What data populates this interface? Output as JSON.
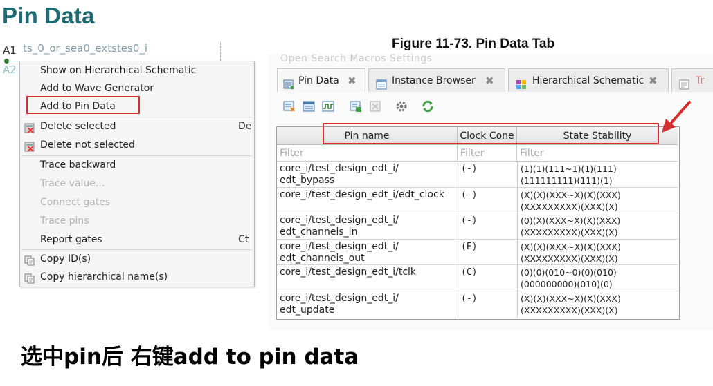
{
  "title": "Pin Data",
  "schematic": {
    "instance_label": "ts_0_or_sea0_extstes0_i",
    "a1": "A1",
    "a2": "A2"
  },
  "context_menu": {
    "items": [
      {
        "label": "Show on Hierarchical Schematic",
        "icon": "",
        "enabled": true,
        "shortcut": ""
      },
      {
        "label": "Add to Wave Generator",
        "icon": "",
        "enabled": true,
        "shortcut": ""
      },
      {
        "label": "Add to Pin Data",
        "icon": "",
        "enabled": true,
        "shortcut": "",
        "highlighted": true
      },
      {
        "label": "Delete selected",
        "icon": "delete-icon",
        "enabled": true,
        "shortcut": "De"
      },
      {
        "label": "Delete not selected",
        "icon": "delete-icon",
        "enabled": true,
        "shortcut": ""
      },
      {
        "label": "Trace backward",
        "icon": "",
        "enabled": true,
        "shortcut": ""
      },
      {
        "label": "Trace value...",
        "icon": "",
        "enabled": false,
        "shortcut": ""
      },
      {
        "label": "Connect gates",
        "icon": "",
        "enabled": false,
        "shortcut": ""
      },
      {
        "label": "Trace pins",
        "icon": "",
        "enabled": false,
        "shortcut": ""
      },
      {
        "label": "Report gates",
        "icon": "",
        "enabled": true,
        "shortcut": "Ct"
      },
      {
        "label": "Copy ID(s)",
        "icon": "copy-icon",
        "enabled": true,
        "shortcut": ""
      },
      {
        "label": "Copy hierarchical name(s)",
        "icon": "copy-icon",
        "enabled": true,
        "shortcut": ""
      }
    ]
  },
  "figure_caption": "Figure 11-73. Pin Data Tab",
  "ghost_menubar": "Open   Search   Macros   Settings",
  "tabs": [
    {
      "label": "Pin Data",
      "icon": "pin-data-icon",
      "active": true
    },
    {
      "label": "Instance Browser",
      "icon": "instance-browser-icon",
      "active": false
    },
    {
      "label": "Hierarchical Schematic",
      "icon": "schematic-icon",
      "active": false
    },
    {
      "label": "Tr",
      "icon": "trace-icon",
      "active": false
    }
  ],
  "toolbar_icons": [
    "add-pin-icon",
    "list-icon",
    "wave-icon",
    "export-icon",
    "clear-icon",
    "settings-icon",
    "refresh-icon"
  ],
  "table": {
    "columns": [
      "Pin name",
      "Clock Cone",
      "State Stability"
    ],
    "filter_placeholder": "Filter",
    "rows": [
      {
        "pin": "core_i/test_design_edt_i/\nedt_bypass",
        "cone": "(-)",
        "stability": "(1)(1)(111~1)(1)(111)\n(111111111)(111)(1)"
      },
      {
        "pin": "core_i/test_design_edt_i/edt_clock",
        "cone": "(-)",
        "stability": "(X)(X)(XXX~X)(X)(XXX)\n(XXXXXXXXX)(XXX)(X)"
      },
      {
        "pin": "core_i/test_design_edt_i/\nedt_channels_in",
        "cone": "(-)",
        "stability": "(0)(X)(XXX~X)(X)(XXX)\n(XXXXXXXXX)(XXX)(X)"
      },
      {
        "pin": "core_i/test_design_edt_i/\nedt_channels_out",
        "cone": "(E)",
        "stability": "(X)(X)(XXX~X)(X)(XXX)\n(XXXXXXXXX)(XXX)(X)"
      },
      {
        "pin": "core_i/test_design_edt_i/tclk",
        "cone": "(C)",
        "stability": "(0)(0)(010~0)(0)(010)\n(000000000)(010)(0)"
      },
      {
        "pin": "core_i/test_design_edt_i/\nedt_update",
        "cone": "(-)",
        "stability": "(X)(X)(XXX~X)(X)(XXX)\n(XXXXXXXXX)(XXX)(X)"
      }
    ]
  },
  "bottom_caption": "选中pin后 右键add to pin data",
  "colors": {
    "title": "#1f6b73",
    "highlight": "#d32f2f"
  }
}
